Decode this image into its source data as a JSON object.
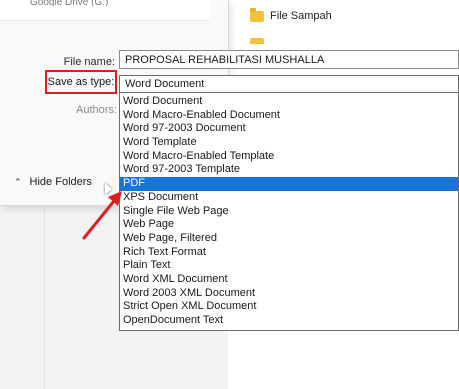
{
  "background": {
    "folder_item_label": "File Sampah",
    "top_partial_text": "Google Drive (G:)"
  },
  "dialog": {
    "file_name_label": "File name:",
    "file_name_value": "PROPOSAL REHABILITASI MUSHALLA",
    "save_as_type_label": "Save as type:",
    "save_as_type_value": "Word Document",
    "authors_label": "Authors:",
    "hide_folders_label": "Hide Folders"
  },
  "dropdown": {
    "selected_index": 7,
    "options": [
      "Word Document",
      "Word Macro-Enabled Document",
      "Word 97-2003 Document",
      "Word Template",
      "Word Macro-Enabled Template",
      "Word 97-2003 Template",
      "PDF",
      "XPS Document",
      "Single File Web Page",
      "Web Page",
      "Web Page, Filtered",
      "Rich Text Format",
      "Plain Text",
      "Word XML Document",
      "Word 2003 XML Document",
      "Strict Open XML Document",
      "OpenDocument Text"
    ]
  },
  "colors": {
    "highlight": "#1874d8",
    "annotation_red": "#e01e1e",
    "folder_yellow": "#f2c23b"
  },
  "icons": {
    "folder": "folder-icon",
    "hide_folders_chevron": "chevron-up-icon",
    "cursor": "mouse-cursor-icon",
    "annotation_arrow": "red-arrow-icon"
  }
}
